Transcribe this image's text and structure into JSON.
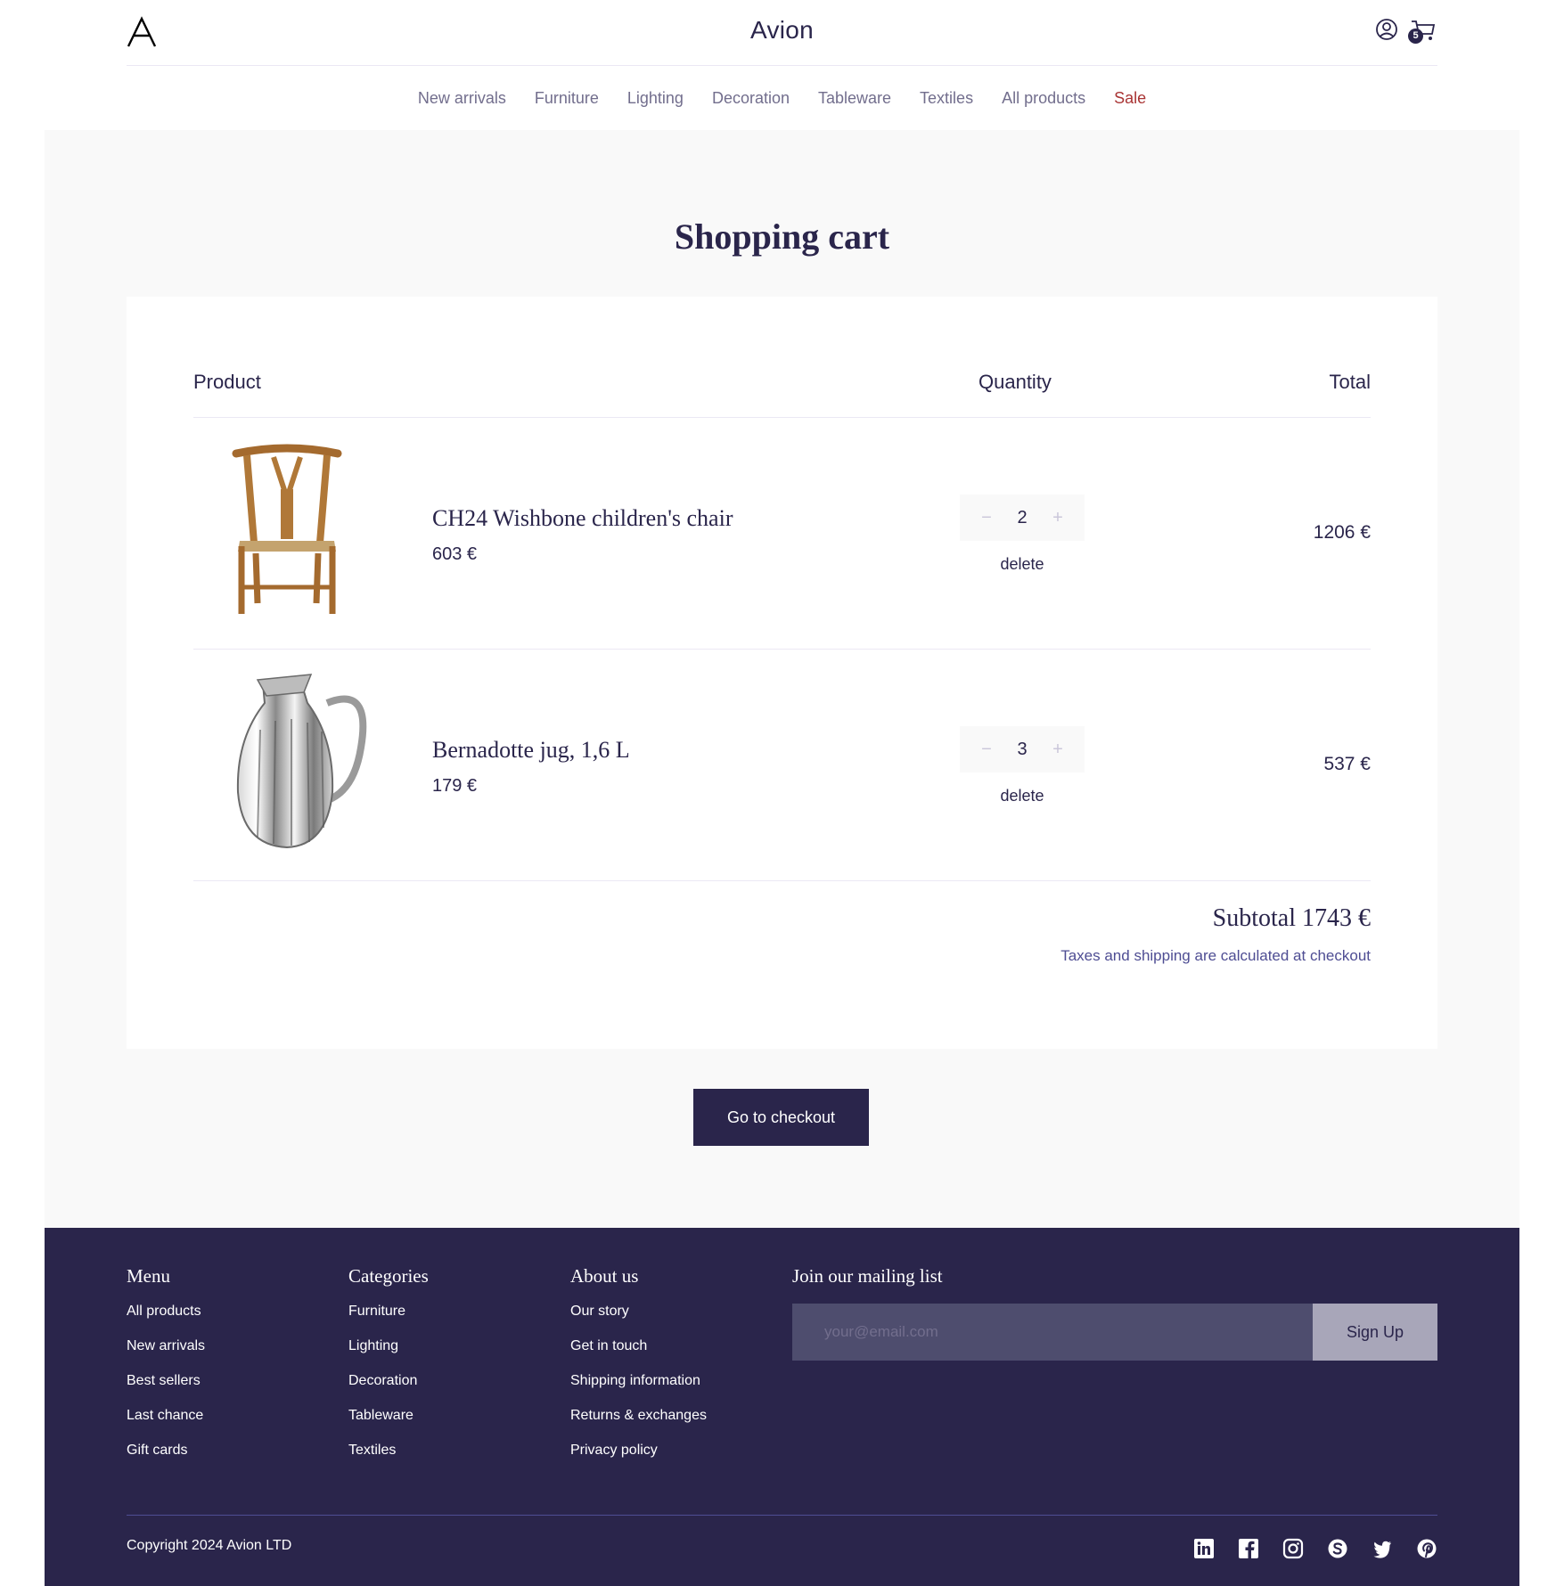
{
  "header": {
    "brand": "Avion",
    "cart_count": "5",
    "icons": [
      "logo-a-icon",
      "user-icon",
      "cart-icon"
    ]
  },
  "nav": {
    "items": [
      "New arrivals",
      "Furniture",
      "Lighting",
      "Decoration",
      "Tableware",
      "Textiles",
      "All products",
      "Sale"
    ]
  },
  "cart": {
    "title": "Shopping cart",
    "columns": {
      "product": "Product",
      "quantity": "Quantity",
      "total": "Total"
    },
    "items": [
      {
        "name": "CH24 Wishbone children's chair",
        "price": "603 €",
        "qty": "2",
        "total": "1206 €",
        "delete": "delete",
        "image_icon": "chair-icon"
      },
      {
        "name": "Bernadotte jug, 1,6 L",
        "price": "179 €",
        "qty": "3",
        "total": "537 €",
        "delete": "delete",
        "image_icon": "jug-icon"
      }
    ],
    "subtotal": "Subtotal 1743 €",
    "tax_note": "Taxes and shipping are calculated at checkout",
    "checkout_label": "Go to checkout"
  },
  "footer": {
    "menu": {
      "title": "Menu",
      "links": [
        "All products",
        "New arrivals",
        "Best sellers",
        "Last chance",
        "Gift cards"
      ]
    },
    "categories": {
      "title": "Categories",
      "links": [
        "Furniture",
        "Lighting",
        "Decoration",
        "Tableware",
        "Textiles"
      ]
    },
    "about": {
      "title": "About us",
      "links": [
        "Our story",
        "Get in touch",
        "Shipping information",
        "Returns & exchanges",
        "Privacy policy"
      ]
    },
    "mailing": {
      "title": "Join our mailing list",
      "placeholder": "your@email.com",
      "button": "Sign Up"
    },
    "copyright": "Copyright 2024 Avion LTD",
    "social": [
      "linkedin-icon",
      "facebook-icon",
      "instagram-icon",
      "skype-icon",
      "twitter-icon",
      "pinterest-icon"
    ]
  },
  "colors": {
    "primary": "#2a254b",
    "sale": "#a93434",
    "muted": "#726e8d",
    "background": "#f9f9f9"
  }
}
